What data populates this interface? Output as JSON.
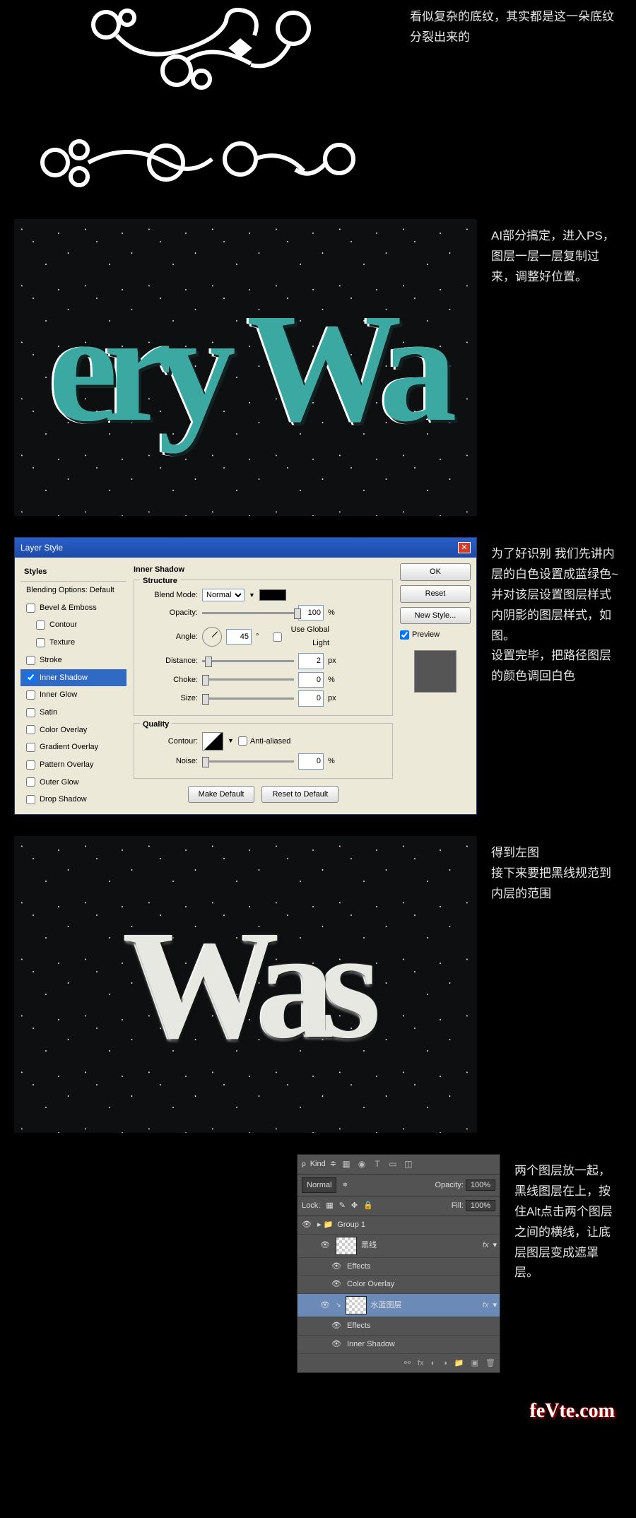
{
  "sec1": {
    "text": "看似复杂的底纹，其实都是这一朵底纹分裂出来的"
  },
  "sec2": {
    "text": "AI部分搞定，进入PS，图层一层一层复制过来，调整好位置。",
    "word1": "ery",
    "word2": "Wa"
  },
  "sec3": {
    "text": "为了好识别 我们先讲内层的白色设置成蓝绿色~并对该层设置图层样式\n内阴影的图层样式，如图。\n设置完毕，把路径图层的颜色调回白色"
  },
  "dlg": {
    "title": "Layer Style",
    "styles_hdr": "Styles",
    "styles": [
      {
        "label": "Blending Options: Default",
        "chk": null
      },
      {
        "label": "Bevel & Emboss",
        "chk": false
      },
      {
        "label": "Contour",
        "chk": false,
        "indent": true
      },
      {
        "label": "Texture",
        "chk": false,
        "indent": true
      },
      {
        "label": "Stroke",
        "chk": false
      },
      {
        "label": "Inner Shadow",
        "chk": true,
        "sel": true
      },
      {
        "label": "Inner Glow",
        "chk": false
      },
      {
        "label": "Satin",
        "chk": false
      },
      {
        "label": "Color Overlay",
        "chk": false
      },
      {
        "label": "Gradient Overlay",
        "chk": false
      },
      {
        "label": "Pattern Overlay",
        "chk": false
      },
      {
        "label": "Outer Glow",
        "chk": false
      },
      {
        "label": "Drop Shadow",
        "chk": false
      }
    ],
    "panel_title": "Inner Shadow",
    "structure": "Structure",
    "blend_mode_label": "Blend Mode:",
    "blend_mode": "Normal",
    "opacity_label": "Opacity:",
    "opacity": "100",
    "pct": "%",
    "angle_label": "Angle:",
    "angle": "45",
    "deg": "°",
    "global_light": "Use Global Light",
    "distance_label": "Distance:",
    "distance": "2",
    "px": "px",
    "choke_label": "Choke:",
    "choke": "0",
    "size_label": "Size:",
    "size": "0",
    "quality": "Quality",
    "contour_label": "Contour:",
    "anti": "Anti-aliased",
    "noise_label": "Noise:",
    "noise": "0",
    "make_default": "Make Default",
    "reset_default": "Reset to Default",
    "ok": "OK",
    "reset": "Reset",
    "new_style": "New Style...",
    "preview": "Preview"
  },
  "sec4": {
    "text": "得到左图\n接下来要把黑线规范到内层的范围",
    "word": "Was"
  },
  "sec5": {
    "text": "两个图层放一起，黑线图层在上，按住Alt点击两个图层之间的横线，让底层图层变成遮罩层。"
  },
  "layers": {
    "kind": "Kind",
    "filters": [
      "▦",
      "◉",
      "T",
      "▭",
      "◫"
    ],
    "mode": "Normal",
    "opacity_l": "Opacity:",
    "opacity": "100%",
    "lock": "Lock:",
    "fill_l": "Fill:",
    "fill": "100%",
    "group": "Group 1",
    "l1": "黑线",
    "l2": "水蓝图层",
    "fx": "fx",
    "effects": "Effects",
    "color_overlay": "Color Overlay",
    "inner_shadow": "Inner Shadow"
  },
  "watermark": "feVte.com"
}
